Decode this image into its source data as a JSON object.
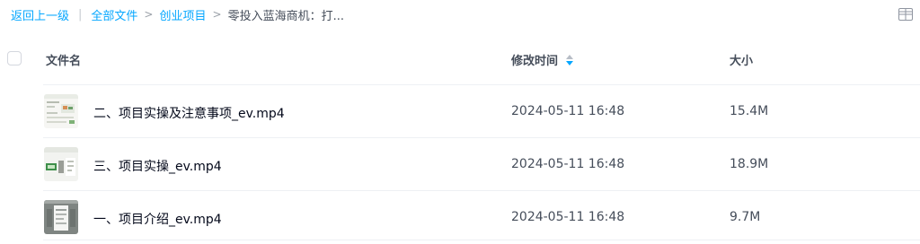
{
  "breadcrumb": {
    "back": "返回上一级",
    "separator": "|",
    "items": [
      "全部文件",
      "创业项目"
    ],
    "current": "零投入蓝海商机：打..."
  },
  "table": {
    "headers": {
      "name": "文件名",
      "modified": "修改时间",
      "size": "大小"
    },
    "sort": {
      "column": "modified",
      "icon": "sort-arrows-icon"
    },
    "rows": [
      {
        "name": "二、项目实操及注意事项_ev.mp4",
        "modified": "2024-05-11 16:48",
        "size": "15.4M",
        "thumbnail": "video-thumbnail"
      },
      {
        "name": "三、项目实操_ev.mp4",
        "modified": "2024-05-11 16:48",
        "size": "18.9M",
        "thumbnail": "video-thumbnail"
      },
      {
        "name": "一、项目介绍_ev.mp4",
        "modified": "2024-05-11 16:48",
        "size": "9.7M",
        "thumbnail": "video-thumbnail"
      }
    ]
  },
  "colors": {
    "link": "#06a7ff",
    "text_primary": "#03081a",
    "text_secondary": "#454d5a",
    "divider": "#eef0f4"
  }
}
